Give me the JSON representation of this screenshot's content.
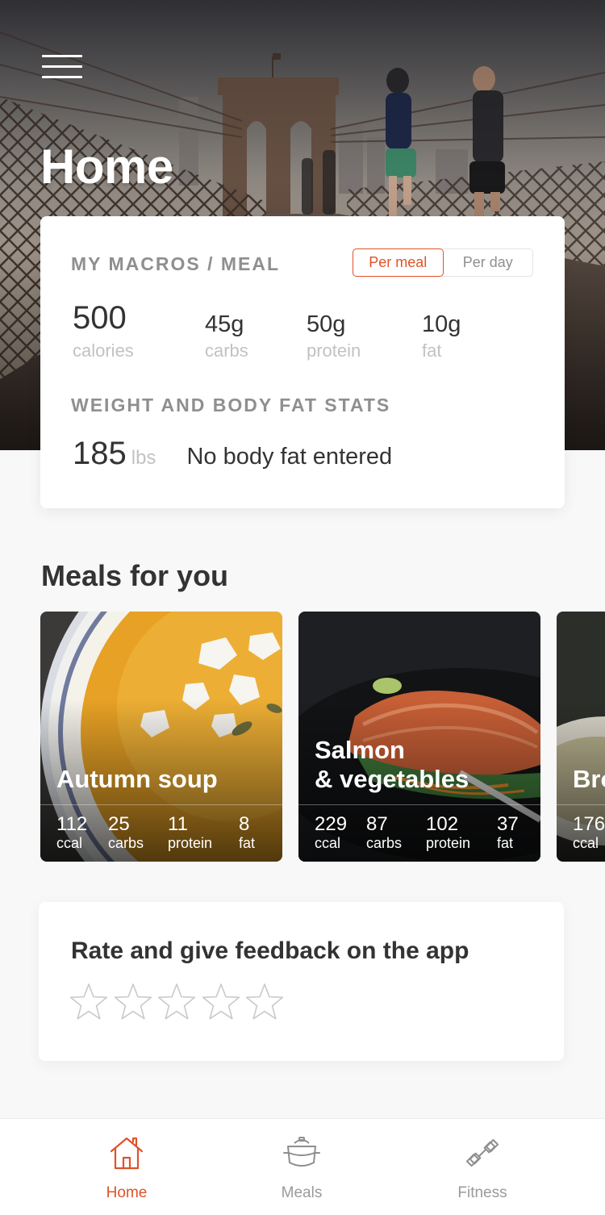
{
  "header": {
    "title": "Home",
    "menu_icon": "hamburger-menu-icon"
  },
  "macros": {
    "section_label": "MY MACROS / MEAL",
    "toggle": {
      "per_meal": "Per meal",
      "per_day": "Per day",
      "selected": "per_meal"
    },
    "calories": {
      "value": "500",
      "unit": "calories"
    },
    "carbs": {
      "value": "45g",
      "unit": "carbs"
    },
    "protein": {
      "value": "50g",
      "unit": "protein"
    },
    "fat": {
      "value": "10g",
      "unit": "fat"
    }
  },
  "weight": {
    "section_label": "WEIGHT AND BODY FAT STATS",
    "value": "185",
    "unit": "lbs",
    "body_fat_text": "No body fat entered"
  },
  "meals": {
    "section_title": "Meals for you",
    "items": [
      {
        "name": "Autumn soup",
        "ccal": "112",
        "carbs": "25",
        "protein": "11",
        "fat": "8",
        "ccal_label": "ccal",
        "carbs_label": "carbs",
        "protein_label": "protein",
        "fat_label": "fat"
      },
      {
        "name": "Salmon\n& vegetables",
        "ccal": "229",
        "carbs": "87",
        "protein": "102",
        "fat": "37",
        "ccal_label": "ccal",
        "carbs_label": "carbs",
        "protein_label": "protein",
        "fat_label": "fat"
      },
      {
        "name": "Bro",
        "ccal": "176",
        "ccal_label": "ccal"
      }
    ]
  },
  "rating": {
    "title": "Rate and give feedback on the app",
    "stars_filled": 0,
    "stars_total": 5
  },
  "nav": {
    "home": {
      "label": "Home",
      "icon": "house-icon"
    },
    "meals": {
      "label": "Meals",
      "icon": "food-bowl-icon"
    },
    "fitness": {
      "label": "Fitness",
      "icon": "dumbbell-icon"
    },
    "active": "home"
  },
  "colors": {
    "accent": "#e0522a",
    "text_dark": "#333333",
    "text_muted": "#8f8f8f",
    "text_light": "#c2c2c2",
    "background": "#f8f8f8"
  }
}
